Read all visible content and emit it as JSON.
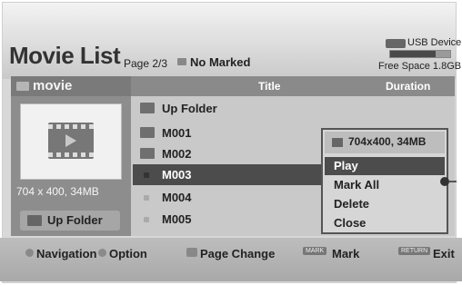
{
  "header": {
    "title": "Movie List",
    "page_info": "Page 2/3",
    "mark_status": "No Marked",
    "usb_label": "USB Device",
    "usb_used_fraction": 0.75,
    "free_space": "Free Space 1.8GB"
  },
  "left_panel": {
    "folder_name": "movie",
    "resolution_info": "704 x 400, 34MB",
    "up_folder_label": "Up Folder"
  },
  "list": {
    "columns": {
      "title": "Title",
      "duration": "Duration"
    },
    "rows": [
      {
        "label": "Up Folder",
        "icon": "folder-up-icon"
      },
      {
        "label": "M001",
        "icon": "folder-icon"
      },
      {
        "label": "M002",
        "icon": "folder-icon"
      },
      {
        "label": "M003",
        "icon": "movie-file-icon",
        "selected": true
      },
      {
        "label": "M004",
        "icon": "movie-file-icon"
      },
      {
        "label": "M005",
        "icon": "movie-file-icon"
      }
    ]
  },
  "context_menu": {
    "info": "704x400, 34MB",
    "items": [
      "Play",
      "Mark All",
      "Delete",
      "Close"
    ],
    "active_index": 0
  },
  "footer": {
    "navigation": "Navigation",
    "option": "Option",
    "page_change": "Page Change",
    "mark_key": "MARK",
    "mark": "Mark",
    "return_key": "RETURN",
    "exit": "Exit"
  }
}
